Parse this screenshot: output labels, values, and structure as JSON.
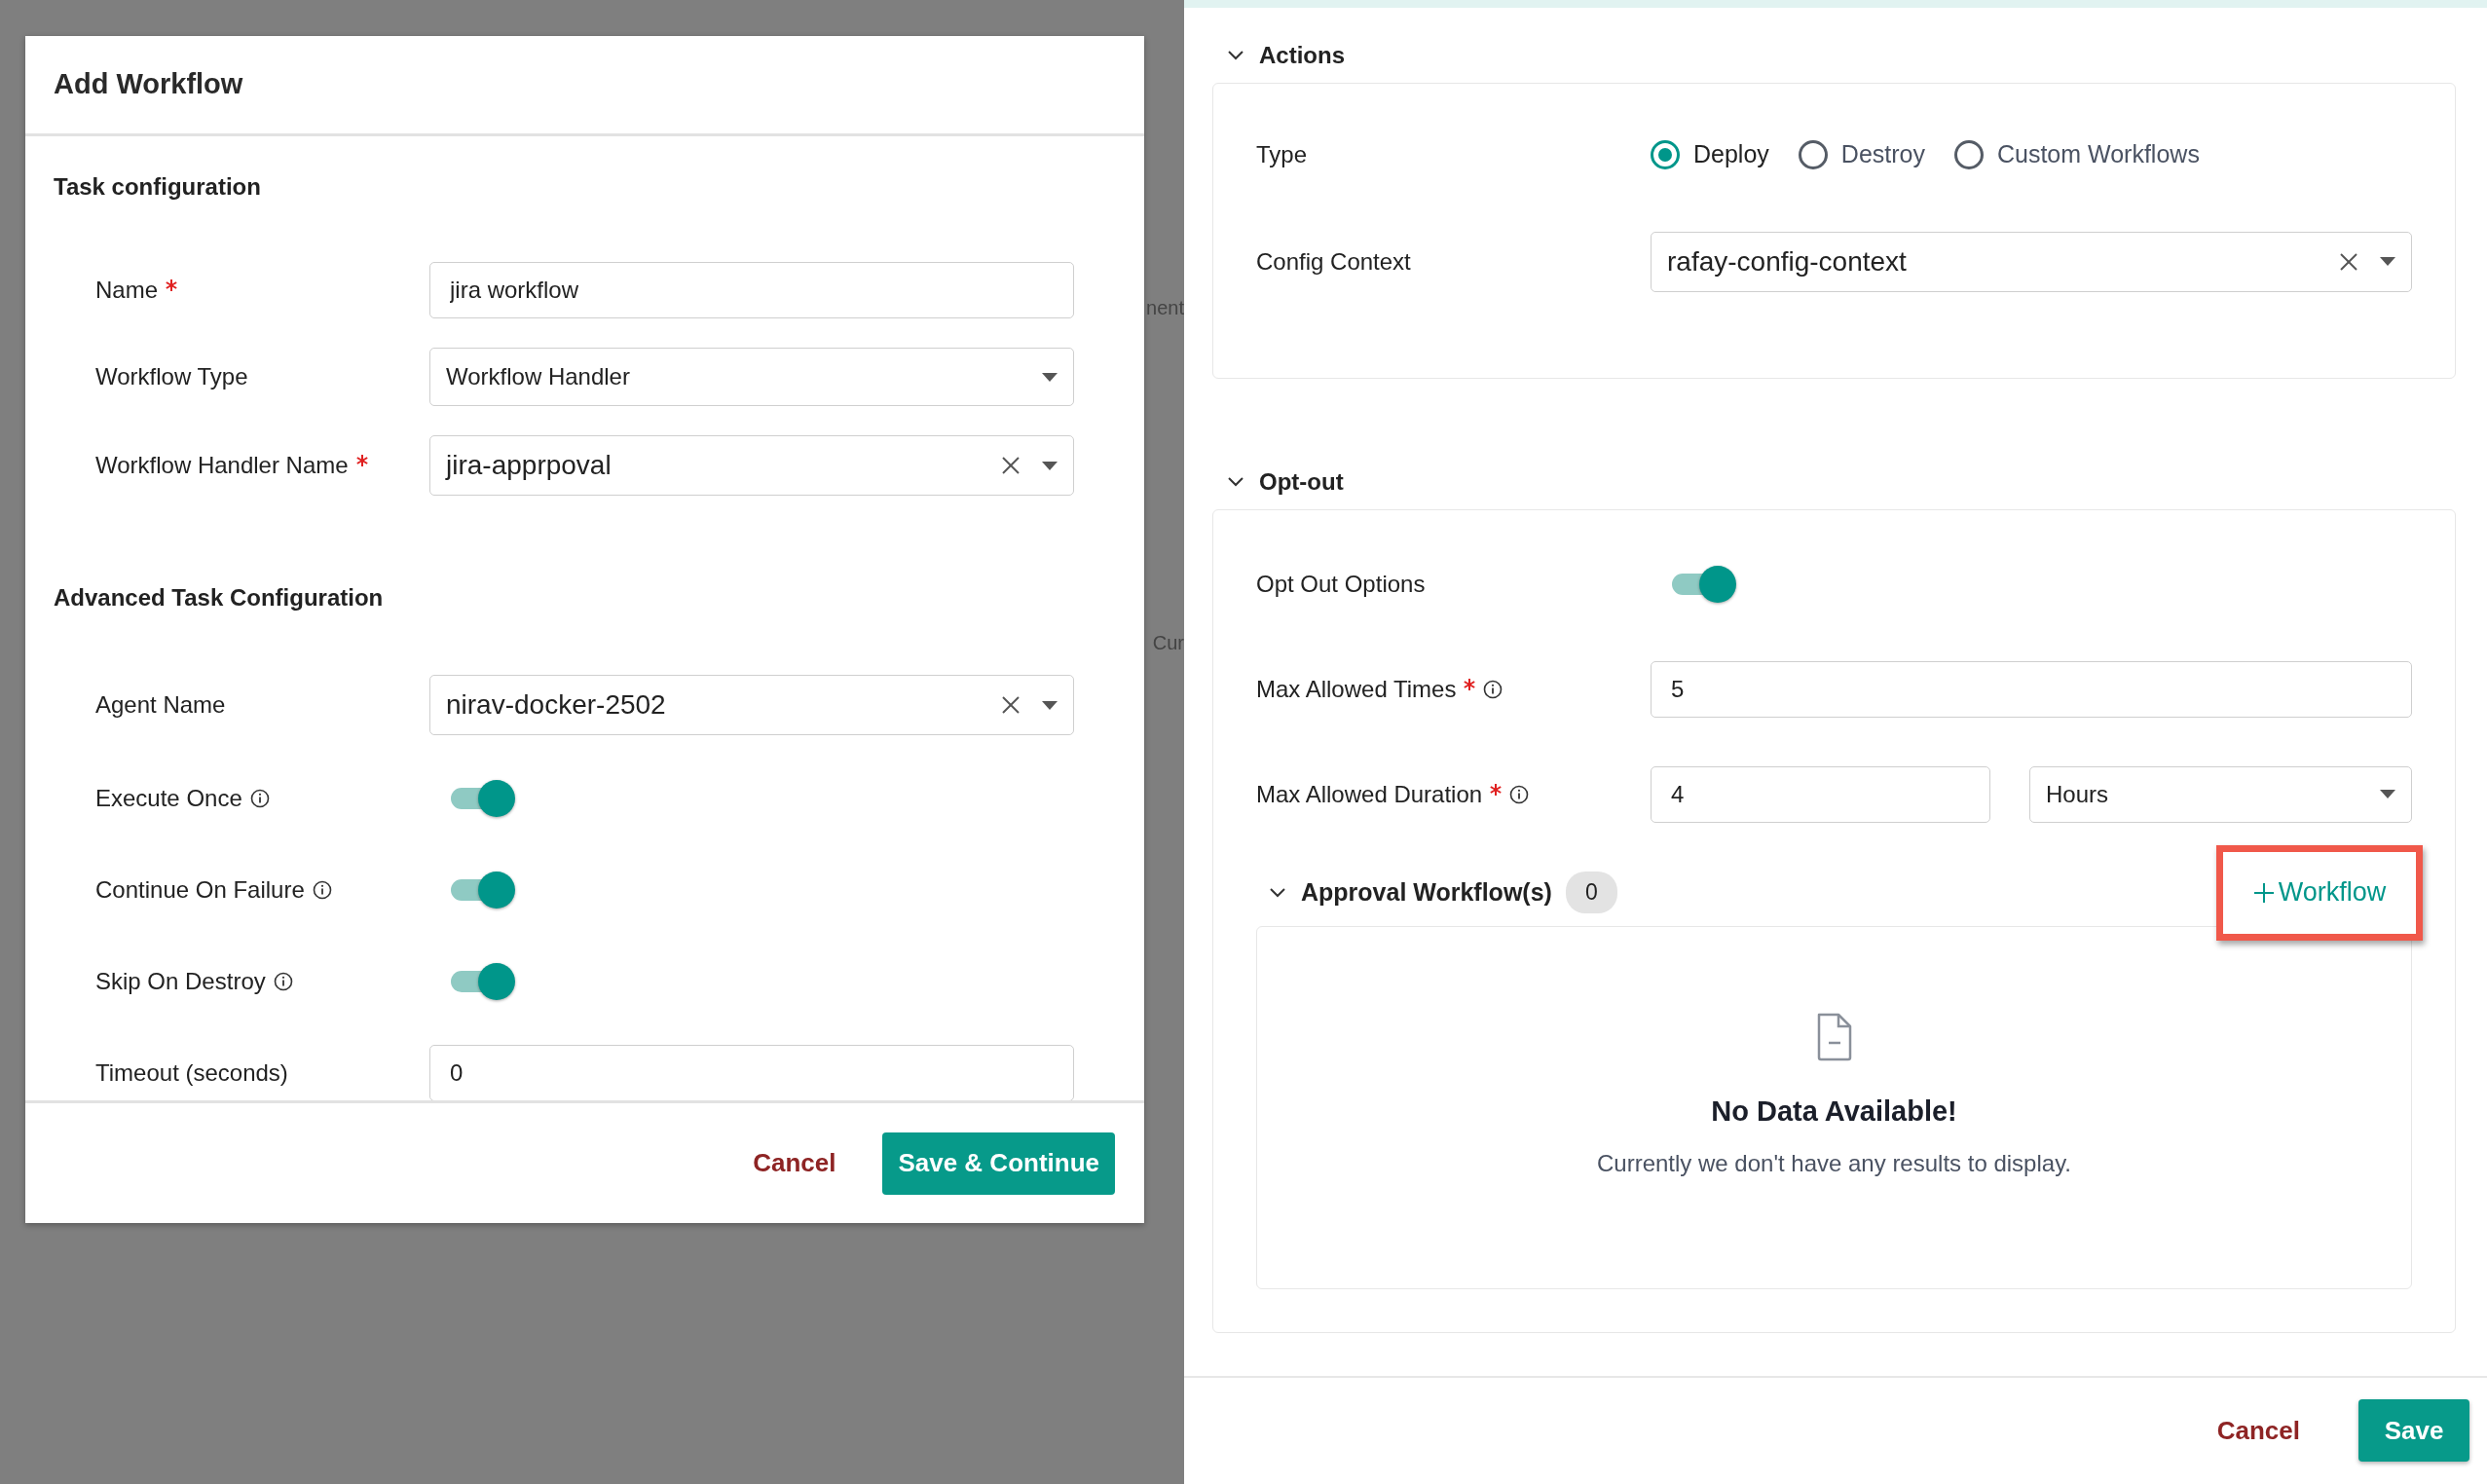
{
  "background_text": [
    "nent",
    "Cur"
  ],
  "modal": {
    "title": "Add Workflow",
    "sections": [
      {
        "heading": "Task configuration",
        "fields": [
          {
            "kind": "text",
            "label": "Name",
            "required": true,
            "info": false,
            "value": "jira workflow"
          },
          {
            "kind": "select",
            "label": "Workflow Type",
            "required": false,
            "info": false,
            "value": "Workflow Handler",
            "clearable": false
          },
          {
            "kind": "select",
            "label": "Workflow Handler Name",
            "required": true,
            "info": false,
            "value": "jira-apprpoval",
            "clearable": true
          }
        ]
      },
      {
        "heading": "Advanced Task Configuration",
        "fields": [
          {
            "kind": "select",
            "label": "Agent Name",
            "required": false,
            "info": false,
            "value": "nirav-docker-2502",
            "clearable": true
          },
          {
            "kind": "toggle",
            "label": "Execute Once",
            "required": false,
            "info": true,
            "on": true
          },
          {
            "kind": "toggle",
            "label": "Continue On Failure",
            "required": false,
            "info": true,
            "on": true
          },
          {
            "kind": "toggle",
            "label": "Skip On Destroy",
            "required": false,
            "info": true,
            "on": true
          },
          {
            "kind": "text",
            "label": "Timeout (seconds)",
            "required": false,
            "info": false,
            "value": "0"
          }
        ]
      }
    ],
    "buttons": [
      {
        "kind": "link",
        "label": "Cancel"
      },
      {
        "kind": "primary",
        "label": "Save & Continue"
      }
    ]
  },
  "panel": {
    "sections": [
      {
        "title": "Actions",
        "expanded": true,
        "fields": [
          {
            "kind": "radio",
            "label": "Type",
            "required": false,
            "info": false,
            "options": [
              {
                "label": "Deploy",
                "selected": true
              },
              {
                "label": "Destroy",
                "selected": false
              },
              {
                "label": "Custom Workflows",
                "selected": false
              }
            ]
          },
          {
            "kind": "select",
            "label": "Config Context",
            "required": false,
            "info": false,
            "value": "rafay-config-context",
            "clearable": true
          }
        ]
      },
      {
        "title": "Opt-out",
        "expanded": true,
        "fields": [
          {
            "kind": "toggle",
            "label": "Opt Out Options",
            "required": false,
            "info": false,
            "on": true
          },
          {
            "kind": "text",
            "label": "Max Allowed Times",
            "required": true,
            "info": true,
            "value": "5"
          },
          {
            "kind": "duration",
            "label": "Max Allowed Duration",
            "required": true,
            "info": true,
            "value": "4",
            "unit": "Hours"
          }
        ],
        "approval": {
          "title": "Approval Workflow(s)",
          "count": "0",
          "expanded": true,
          "add_button": {
            "label": "Workflow",
            "highlighted": true
          },
          "empty": {
            "title": "No Data Available!",
            "message": "Currently we don't have any results to display."
          }
        }
      }
    ],
    "buttons": [
      {
        "kind": "link",
        "label": "Cancel"
      },
      {
        "kind": "primary",
        "label": "Save"
      }
    ]
  }
}
